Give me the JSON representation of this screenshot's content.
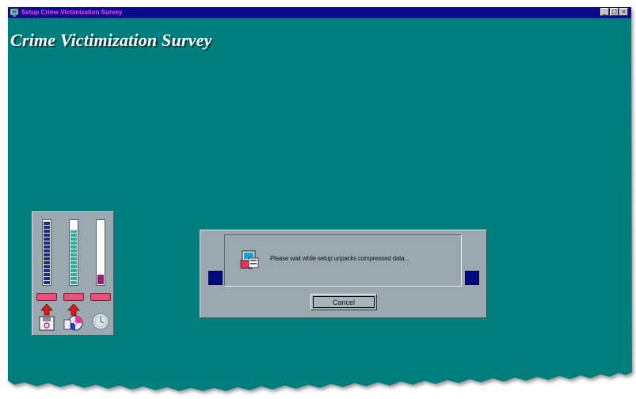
{
  "window": {
    "title": "Setup Crime Victimization Survey",
    "background_color": "#067e7e",
    "titlebar_color": "#0a0a8a",
    "title_text_color": "#ff3cff",
    "controls": {
      "minimize": "_",
      "maximize": "□",
      "close": "×"
    }
  },
  "heading": "Crime Victimization Survey",
  "meters": [
    {
      "name": "source-disk-meter",
      "level": 1.0,
      "color": "#1c2c8c",
      "style": "segmented",
      "icon": "floppy-disk-icon"
    },
    {
      "name": "destination-disk-meter",
      "level": 0.85,
      "color": "#2cae9c",
      "style": "segmented",
      "icon": "hard-drive-icon"
    },
    {
      "name": "free-space-meter",
      "level": 0.15,
      "color": "#9c1e7c",
      "style": "solid",
      "icon": "clock-icon"
    }
  ],
  "dialog": {
    "message": "Please wait while setup unpacks compressed data...",
    "cancel_label": "Cancel",
    "icon": "unpack-computer-icon"
  }
}
